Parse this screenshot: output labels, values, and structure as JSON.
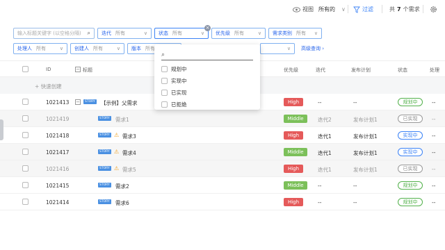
{
  "toolbar": {
    "view_label": "视图",
    "view_value": "所有的",
    "filter_label": "过滤",
    "count_prefix": "共",
    "count_value": "7",
    "count_suffix": "个需求"
  },
  "filters": {
    "search_placeholder": "输入标题关键字 (以空格分隔)",
    "iteration": {
      "label": "迭代",
      "value": "所有"
    },
    "state": {
      "label": "状态",
      "value": "所有"
    },
    "priority": {
      "label": "优先级",
      "value": "所有"
    },
    "category": {
      "label": "需求类别",
      "value": "所有"
    },
    "handler": {
      "label": "处理人",
      "value": "所有"
    },
    "creator": {
      "label": "创建人",
      "value": "所有"
    },
    "version": {
      "label": "版本",
      "value": "所有"
    },
    "advanced": "高级查询"
  },
  "dropdown": {
    "options": [
      "规划中",
      "实现中",
      "已实现",
      "已拒绝"
    ]
  },
  "table": {
    "headers": {
      "id": "ID",
      "title": "标题",
      "priority": "优先级",
      "iteration": "迭代",
      "release": "发布计划",
      "status": "状态",
      "handler": "处理"
    },
    "quick_create": "+ 快速创建",
    "story_tag": "STORY",
    "rows": [
      {
        "id": "1021413",
        "title": "【示例】父需求",
        "priority": "High",
        "iteration": "--",
        "release": "--",
        "status": "规划中",
        "handler": "--"
      },
      {
        "id": "1021419",
        "title": "需求1",
        "priority": "Middle",
        "iteration": "迭代2",
        "release": "发布计划1",
        "status": "已实现",
        "handler": "--"
      },
      {
        "id": "1021418",
        "title": "需求3",
        "priority": "High",
        "iteration": "迭代1",
        "release": "发布计划1",
        "status": "实现中",
        "handler": "--"
      },
      {
        "id": "1021417",
        "title": "需求4",
        "priority": "Middle",
        "iteration": "迭代1",
        "release": "发布计划1",
        "status": "实现中",
        "handler": "--"
      },
      {
        "id": "1021416",
        "title": "需求5",
        "priority": "High",
        "iteration": "迭代1",
        "release": "发布计划1",
        "status": "已实现",
        "handler": "--"
      },
      {
        "id": "1021415",
        "title": "需求2",
        "priority": "Middle",
        "iteration": "--",
        "release": "--",
        "status": "规划中",
        "handler": "--"
      },
      {
        "id": "1021414",
        "title": "需求6",
        "priority": "High",
        "iteration": "--",
        "release": "--",
        "status": "规划中",
        "handler": "--"
      }
    ]
  },
  "colors": {
    "accent": "#3b82f6",
    "high": "#e55a5a",
    "middle": "#7cc05a",
    "planning": "#52b14a",
    "implementing": "#3b82f6",
    "done": "#888888"
  }
}
